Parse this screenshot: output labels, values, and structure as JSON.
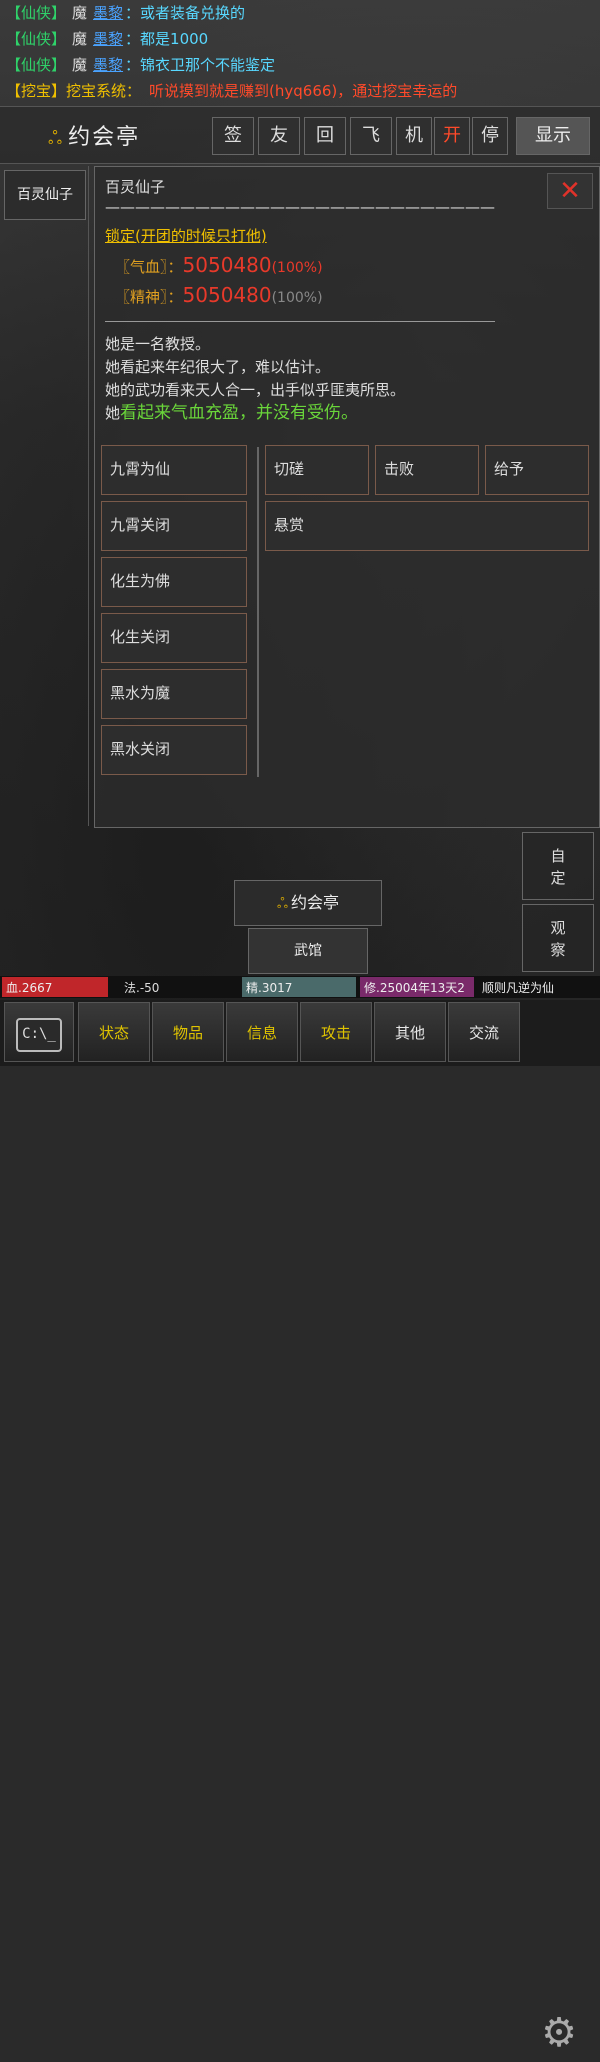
{
  "chat": [
    {
      "channel": "【仙侠】",
      "mo": "魔",
      "name": "墨黎",
      "text": "：或者装备兑换的",
      "type": "normal"
    },
    {
      "channel": "【仙侠】",
      "mo": "魔",
      "name": "墨黎",
      "text": "：都是1000",
      "type": "normal"
    },
    {
      "channel": "【仙侠】",
      "mo": "魔",
      "name": "墨黎",
      "text": "：锦衣卫那个不能鉴定",
      "type": "normal"
    },
    {
      "channel": "【挖宝】",
      "sys": "挖宝系统：",
      "text": "听说摸到就是赚到(hyq666)，通过挖宝幸运的",
      "type": "system"
    }
  ],
  "header": {
    "logo": "约会亭",
    "buttons": [
      "签",
      "友",
      "回",
      "飞",
      "机",
      "开",
      "停"
    ],
    "show": "显示"
  },
  "left_tab": "百灵仙子",
  "panel": {
    "close": "✕",
    "title": "百灵仙子——————————————————————————",
    "lock": "锁定(开团的时候只打他)",
    "hp_label": "〖气血〗：",
    "hp_value": "5050480",
    "hp_pct": "(100%)",
    "sp_label": "〖精神〗：",
    "sp_value": "5050480",
    "sp_pct": "(100%)",
    "desc1": "她是一名教授。",
    "desc2": "她看起来年纪很大了，难以估计。",
    "desc3": "她的武功看来天人合一，出手似乎匪夷所思。",
    "desc4_a": "她",
    "desc4_b": "看起来气血充盈，并没有受伤。",
    "left_buttons": [
      "九霄为仙",
      "九霄关闭",
      "化生为佛",
      "化生关闭",
      "黑水为魔",
      "黑水关闭"
    ],
    "right_buttons": [
      "切磋",
      "击败",
      "给予",
      "悬赏"
    ]
  },
  "side": {
    "custom": "自定",
    "observe": "观察"
  },
  "location": {
    "main": "约会亭",
    "sub": "武馆"
  },
  "status": {
    "hp": "血.2667",
    "mp": "法.-50",
    "jing": "精.3017",
    "xiu": "修.25004年13天2",
    "rule": "顺则凡逆为仙"
  },
  "nav": {
    "cmd": "C:\\_",
    "items": [
      "状态",
      "物品",
      "信息",
      "攻击",
      "其他",
      "交流"
    ]
  },
  "colors": {
    "accent": "#f0c000",
    "danger": "#e8392a",
    "green": "#6ad63a"
  }
}
